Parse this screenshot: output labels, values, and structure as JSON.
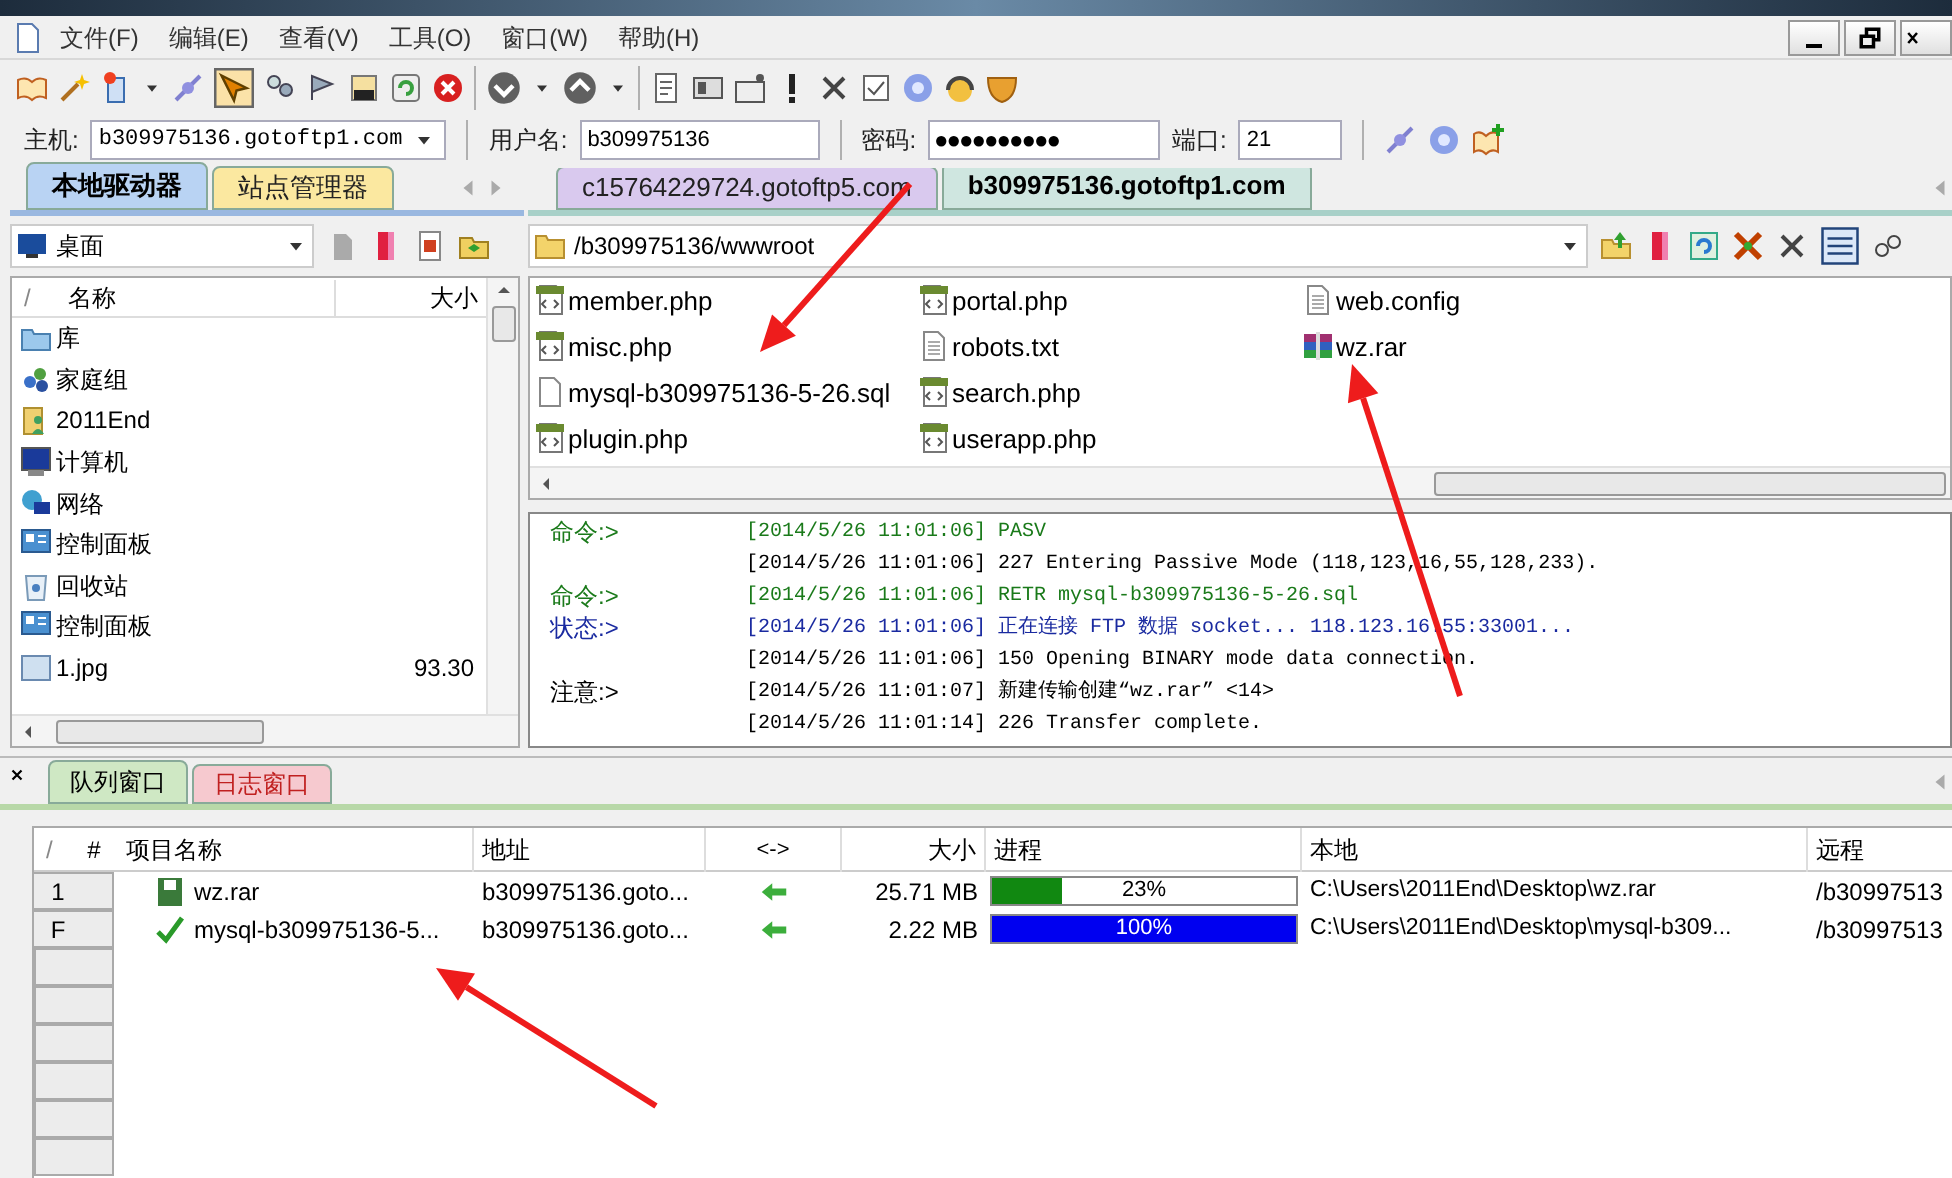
{
  "menu": [
    "文件(F)",
    "编辑(E)",
    "查看(V)",
    "工具(O)",
    "窗口(W)",
    "帮助(H)"
  ],
  "connection": {
    "host_label": "主机:",
    "host": "b309975136.gotoftp1.com",
    "user_label": "用户名:",
    "user": "b309975136",
    "password_label": "密码:",
    "password": "●●●●●●●●●●",
    "port_label": "端口:",
    "port": "21"
  },
  "left_tabs": [
    {
      "label": "本地驱动器",
      "selected": true,
      "color": "#b9d3f3"
    },
    {
      "label": "站点管理器",
      "selected": false,
      "color": "#fbe8a0"
    }
  ],
  "right_tabs": [
    {
      "label": "c15764229724.gotoftp5.com",
      "selected": false,
      "color": "#d9c9ee"
    },
    {
      "label": "b309975136.gotoftp1.com",
      "selected": true,
      "color": "#cfe6e0"
    }
  ],
  "local": {
    "location": "桌面",
    "columns": [
      "/",
      "名称",
      "大小"
    ],
    "items": [
      {
        "name": "库",
        "kind": "library"
      },
      {
        "name": "家庭组",
        "kind": "homegroup"
      },
      {
        "name": "2011End",
        "kind": "user"
      },
      {
        "name": "计算机",
        "kind": "computer"
      },
      {
        "name": "网络",
        "kind": "network"
      },
      {
        "name": "控制面板",
        "kind": "panel"
      },
      {
        "name": "回收站",
        "kind": "bin"
      },
      {
        "name": "控制面板",
        "kind": "panel"
      },
      {
        "name": "1.jpg",
        "kind": "image",
        "size": "93.30"
      }
    ]
  },
  "remote": {
    "path": "/b309975136/wwwroot",
    "files": [
      {
        "name": "member.php",
        "kind": "php"
      },
      {
        "name": "misc.php",
        "kind": "php"
      },
      {
        "name": "mysql-b309975136-5-26.sql",
        "kind": "plain"
      },
      {
        "name": "plugin.php",
        "kind": "php"
      },
      {
        "name": "portal.php",
        "kind": "php"
      },
      {
        "name": "robots.txt",
        "kind": "text"
      },
      {
        "name": "search.php",
        "kind": "php"
      },
      {
        "name": "userapp.php",
        "kind": "php"
      },
      {
        "name": "web.config",
        "kind": "text"
      },
      {
        "name": "wz.rar",
        "kind": "archive"
      }
    ]
  },
  "log": [
    {
      "label": "命令:>",
      "text": "[2014/5/26 11:01:06] PASV",
      "kind": "command"
    },
    {
      "text": "[2014/5/26 11:01:06] 227 Entering Passive Mode (118,123,16,55,128,233).",
      "kind": "reply"
    },
    {
      "label": "命令:>",
      "text": "[2014/5/26 11:01:06] RETR mysql-b309975136-5-26.sql",
      "kind": "command"
    },
    {
      "label": "状态:>",
      "text": "[2014/5/26 11:01:06] 正在连接 FTP 数据 socket... 118.123.16.55:33001...",
      "kind": "status"
    },
    {
      "text": "[2014/5/26 11:01:06] 150 Opening BINARY mode data connection.",
      "kind": "reply"
    },
    {
      "label": "注意:>",
      "text": "[2014/5/26 11:01:07] 新建传输创建“wz.rar” <14>",
      "kind": "note"
    },
    {
      "text": "[2014/5/26 11:01:14] 226 Transfer complete.",
      "kind": "reply"
    }
  ],
  "bottom_tabs": [
    {
      "label": "队列窗口",
      "selected": true,
      "color": "#cfe8c4"
    },
    {
      "label": "日志窗口",
      "selected": false,
      "color": "#f6c9cf"
    }
  ],
  "queue": {
    "columns": [
      "/",
      "#",
      "项目名称",
      "地址",
      "<->",
      "大小",
      "进程",
      "本地",
      "远程"
    ],
    "rows": [
      {
        "number": "1",
        "done": false,
        "name": "wz.rar",
        "address": "b309975136.goto...",
        "size": "25.71 MB",
        "level": 0.23,
        "progress": "23%",
        "local": "C:\\Users\\2011End\\Desktop\\wz.rar",
        "remote": "/b30997513"
      },
      {
        "number": "F",
        "done": true,
        "name": "mysql-b309975136-5...",
        "address": "b309975136.goto...",
        "size": "2.22 MB",
        "level": 1,
        "progress": "100%",
        "local": "C:\\Users\\2011End\\Desktop\\mysql-b309...",
        "remote": "/b30997513"
      }
    ]
  }
}
